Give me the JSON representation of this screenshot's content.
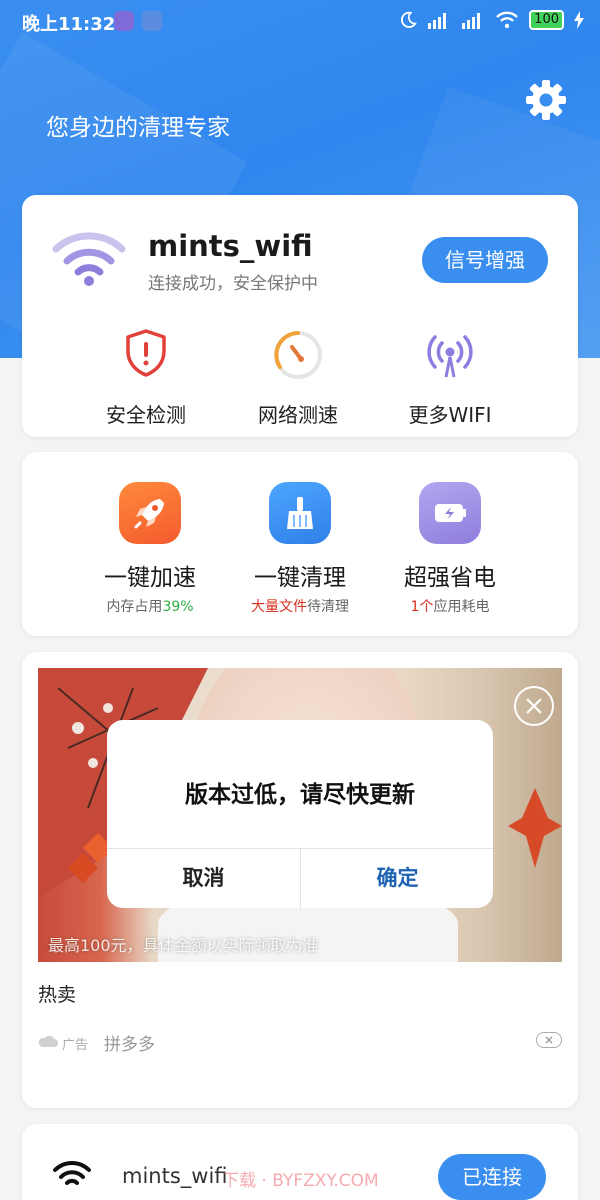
{
  "status_bar": {
    "time": "晚上11:32",
    "battery": "100"
  },
  "header": {
    "tagline": "您身边的清理专家",
    "settings_icon": "gear-icon"
  },
  "wifi_card": {
    "ssid": "mints_wifi",
    "status": "连接成功，安全保护中",
    "boost_button": "信号增强",
    "features": [
      {
        "label": "安全检测",
        "icon": "shield-alert-icon",
        "color": "#e2403a"
      },
      {
        "label": "网络测速",
        "icon": "speedometer-icon",
        "color": "#f2a23b"
      },
      {
        "label": "更多WIFI",
        "icon": "antenna-icon",
        "color": "#8e7ce0"
      }
    ]
  },
  "tools_card": {
    "items": [
      {
        "title": "一键加速",
        "sub_highlight": "",
        "sub_text": "内存占用",
        "sub_value": "39%",
        "icon": "rocket-icon",
        "color": "#f76a32"
      },
      {
        "title": "一键清理",
        "sub_highlight": "大量文件",
        "sub_text": "待清理",
        "sub_value": "",
        "icon": "broom-icon",
        "color": "#3b8ff0"
      },
      {
        "title": "超强省电",
        "sub_highlight": "1个",
        "sub_text": "应用耗电",
        "sub_value": "",
        "icon": "battery-icon",
        "color": "#9d8be6"
      }
    ]
  },
  "ad_card": {
    "image_caption": "最高100元，具体金额以实际领取为准",
    "title": "热卖",
    "ad_tag": "广告",
    "brand": "拼多多"
  },
  "dialog": {
    "message": "版本过低，请尽快更新",
    "cancel": "取消",
    "confirm": "确定"
  },
  "connected_card": {
    "ssid": "mints_wifi",
    "button": "已连接",
    "watermark": "下载 · BYFZXY.COM"
  },
  "colors": {
    "primary": "#3a8ef0",
    "dialog_confirm": "#1e63b3"
  }
}
